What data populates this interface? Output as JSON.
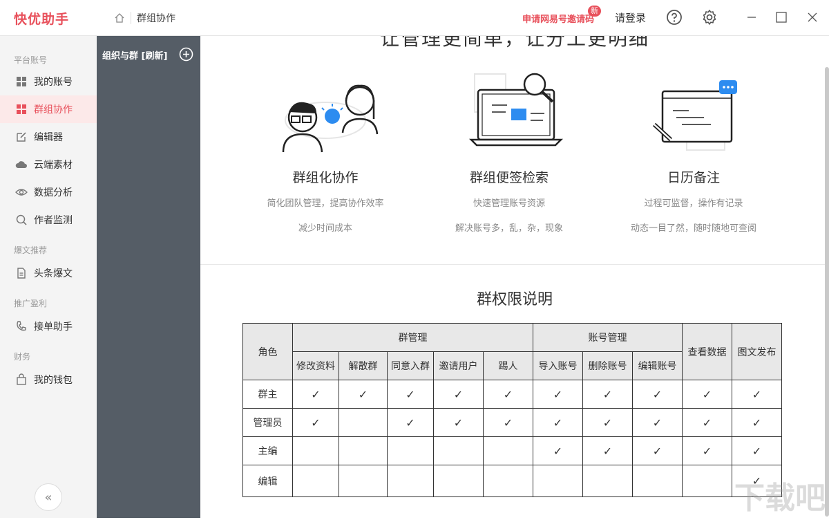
{
  "app": {
    "logo": "快优助手"
  },
  "topbar": {
    "breadcrumb": "群组协作",
    "invite_label": "申请网易号邀请码",
    "new_badge": "新",
    "login_label": "请登录"
  },
  "sidebar": {
    "sections": {
      "platform": "平台账号",
      "explosive": "爆文推荐",
      "promo": "推广盈利",
      "finance": "财务"
    },
    "items": {
      "my_account": "我的账号",
      "group_collab": "群组协作",
      "editor": "编辑器",
      "cloud": "云端素材",
      "analysis": "数据分析",
      "monitor": "作者监测",
      "toutiao": "头条爆文",
      "orders": "接单助手",
      "wallet": "我的钱包"
    }
  },
  "org_panel": {
    "title": "组织与群 [刷新]"
  },
  "main": {
    "slogan": "让管理更简单，让分工更明细",
    "features": [
      {
        "title": "群组化协作",
        "desc1": "简化团队管理，提高协作效率",
        "desc2": "减少时间成本"
      },
      {
        "title": "群组便签检索",
        "desc1": "快速管理账号资源",
        "desc2": "解决账号多，乱，杂，现象"
      },
      {
        "title": "日历备注",
        "desc1": "过程可监督，操作有记录",
        "desc2": "动态一目了然，随时随地可查阅"
      }
    ],
    "perm_title": "群权限说明"
  },
  "table": {
    "role_header": "角色",
    "group_mgmt": "群管理",
    "account_mgmt": "账号管理",
    "view_data": "查看数据",
    "publish": "图文发布",
    "sub_headers": [
      "修改资料",
      "解散群",
      "同意入群",
      "邀请用户",
      "踢人",
      "导入账号",
      "删除账号",
      "编辑账号"
    ],
    "rows": [
      {
        "role": "群主",
        "checks": [
          1,
          1,
          1,
          1,
          1,
          1,
          1,
          1,
          1,
          1
        ]
      },
      {
        "role": "管理员",
        "checks": [
          1,
          0,
          1,
          1,
          1,
          1,
          1,
          1,
          1,
          1
        ]
      },
      {
        "role": "主编",
        "checks": [
          0,
          0,
          0,
          0,
          0,
          1,
          1,
          1,
          1,
          1
        ]
      },
      {
        "role": "编辑",
        "checks": [
          0,
          0,
          0,
          0,
          0,
          0,
          0,
          0,
          0,
          1
        ]
      }
    ],
    "check_symbol": "✓"
  },
  "colors": {
    "brand": "#e8505b",
    "panel": "#555d66"
  }
}
